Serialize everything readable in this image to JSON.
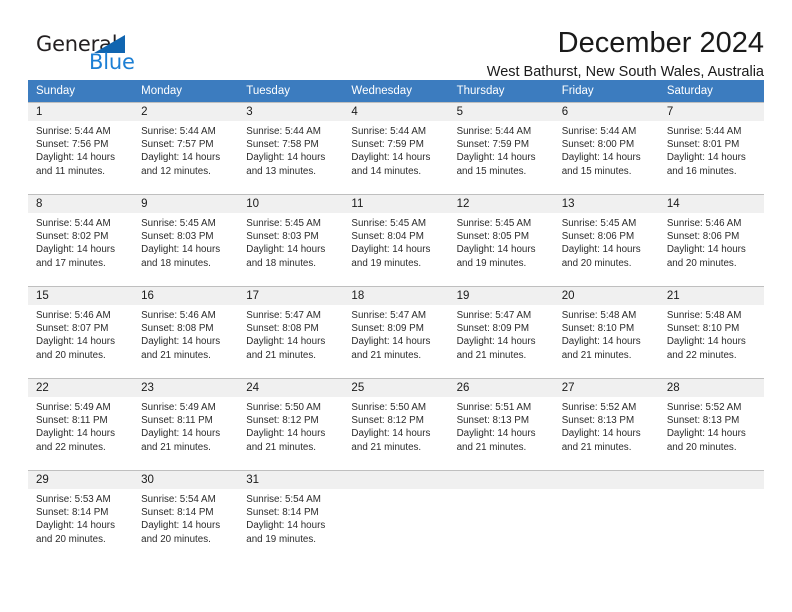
{
  "brand": {
    "name_part1": "General",
    "name_part2": "Blue",
    "triangle_color": "#1065b0",
    "blue_color": "#1c7fd4"
  },
  "header": {
    "month_title": "December 2024",
    "location": "West Bathurst, New South Wales, Australia"
  },
  "theme": {
    "header_row_bg": "#3c7cbf",
    "daynum_bg": "#f0f0f0",
    "grid_line": "#bfbfbf"
  },
  "weekdays": [
    "Sunday",
    "Monday",
    "Tuesday",
    "Wednesday",
    "Thursday",
    "Friday",
    "Saturday"
  ],
  "weeks": [
    [
      {
        "day": "1",
        "sunrise": "Sunrise: 5:44 AM",
        "sunset": "Sunset: 7:56 PM",
        "daylight1": "Daylight: 14 hours",
        "daylight2": "and 11 minutes."
      },
      {
        "day": "2",
        "sunrise": "Sunrise: 5:44 AM",
        "sunset": "Sunset: 7:57 PM",
        "daylight1": "Daylight: 14 hours",
        "daylight2": "and 12 minutes."
      },
      {
        "day": "3",
        "sunrise": "Sunrise: 5:44 AM",
        "sunset": "Sunset: 7:58 PM",
        "daylight1": "Daylight: 14 hours",
        "daylight2": "and 13 minutes."
      },
      {
        "day": "4",
        "sunrise": "Sunrise: 5:44 AM",
        "sunset": "Sunset: 7:59 PM",
        "daylight1": "Daylight: 14 hours",
        "daylight2": "and 14 minutes."
      },
      {
        "day": "5",
        "sunrise": "Sunrise: 5:44 AM",
        "sunset": "Sunset: 7:59 PM",
        "daylight1": "Daylight: 14 hours",
        "daylight2": "and 15 minutes."
      },
      {
        "day": "6",
        "sunrise": "Sunrise: 5:44 AM",
        "sunset": "Sunset: 8:00 PM",
        "daylight1": "Daylight: 14 hours",
        "daylight2": "and 15 minutes."
      },
      {
        "day": "7",
        "sunrise": "Sunrise: 5:44 AM",
        "sunset": "Sunset: 8:01 PM",
        "daylight1": "Daylight: 14 hours",
        "daylight2": "and 16 minutes."
      }
    ],
    [
      {
        "day": "8",
        "sunrise": "Sunrise: 5:44 AM",
        "sunset": "Sunset: 8:02 PM",
        "daylight1": "Daylight: 14 hours",
        "daylight2": "and 17 minutes."
      },
      {
        "day": "9",
        "sunrise": "Sunrise: 5:45 AM",
        "sunset": "Sunset: 8:03 PM",
        "daylight1": "Daylight: 14 hours",
        "daylight2": "and 18 minutes."
      },
      {
        "day": "10",
        "sunrise": "Sunrise: 5:45 AM",
        "sunset": "Sunset: 8:03 PM",
        "daylight1": "Daylight: 14 hours",
        "daylight2": "and 18 minutes."
      },
      {
        "day": "11",
        "sunrise": "Sunrise: 5:45 AM",
        "sunset": "Sunset: 8:04 PM",
        "daylight1": "Daylight: 14 hours",
        "daylight2": "and 19 minutes."
      },
      {
        "day": "12",
        "sunrise": "Sunrise: 5:45 AM",
        "sunset": "Sunset: 8:05 PM",
        "daylight1": "Daylight: 14 hours",
        "daylight2": "and 19 minutes."
      },
      {
        "day": "13",
        "sunrise": "Sunrise: 5:45 AM",
        "sunset": "Sunset: 8:06 PM",
        "daylight1": "Daylight: 14 hours",
        "daylight2": "and 20 minutes."
      },
      {
        "day": "14",
        "sunrise": "Sunrise: 5:46 AM",
        "sunset": "Sunset: 8:06 PM",
        "daylight1": "Daylight: 14 hours",
        "daylight2": "and 20 minutes."
      }
    ],
    [
      {
        "day": "15",
        "sunrise": "Sunrise: 5:46 AM",
        "sunset": "Sunset: 8:07 PM",
        "daylight1": "Daylight: 14 hours",
        "daylight2": "and 20 minutes."
      },
      {
        "day": "16",
        "sunrise": "Sunrise: 5:46 AM",
        "sunset": "Sunset: 8:08 PM",
        "daylight1": "Daylight: 14 hours",
        "daylight2": "and 21 minutes."
      },
      {
        "day": "17",
        "sunrise": "Sunrise: 5:47 AM",
        "sunset": "Sunset: 8:08 PM",
        "daylight1": "Daylight: 14 hours",
        "daylight2": "and 21 minutes."
      },
      {
        "day": "18",
        "sunrise": "Sunrise: 5:47 AM",
        "sunset": "Sunset: 8:09 PM",
        "daylight1": "Daylight: 14 hours",
        "daylight2": "and 21 minutes."
      },
      {
        "day": "19",
        "sunrise": "Sunrise: 5:47 AM",
        "sunset": "Sunset: 8:09 PM",
        "daylight1": "Daylight: 14 hours",
        "daylight2": "and 21 minutes."
      },
      {
        "day": "20",
        "sunrise": "Sunrise: 5:48 AM",
        "sunset": "Sunset: 8:10 PM",
        "daylight1": "Daylight: 14 hours",
        "daylight2": "and 21 minutes."
      },
      {
        "day": "21",
        "sunrise": "Sunrise: 5:48 AM",
        "sunset": "Sunset: 8:10 PM",
        "daylight1": "Daylight: 14 hours",
        "daylight2": "and 22 minutes."
      }
    ],
    [
      {
        "day": "22",
        "sunrise": "Sunrise: 5:49 AM",
        "sunset": "Sunset: 8:11 PM",
        "daylight1": "Daylight: 14 hours",
        "daylight2": "and 22 minutes."
      },
      {
        "day": "23",
        "sunrise": "Sunrise: 5:49 AM",
        "sunset": "Sunset: 8:11 PM",
        "daylight1": "Daylight: 14 hours",
        "daylight2": "and 21 minutes."
      },
      {
        "day": "24",
        "sunrise": "Sunrise: 5:50 AM",
        "sunset": "Sunset: 8:12 PM",
        "daylight1": "Daylight: 14 hours",
        "daylight2": "and 21 minutes."
      },
      {
        "day": "25",
        "sunrise": "Sunrise: 5:50 AM",
        "sunset": "Sunset: 8:12 PM",
        "daylight1": "Daylight: 14 hours",
        "daylight2": "and 21 minutes."
      },
      {
        "day": "26",
        "sunrise": "Sunrise: 5:51 AM",
        "sunset": "Sunset: 8:13 PM",
        "daylight1": "Daylight: 14 hours",
        "daylight2": "and 21 minutes."
      },
      {
        "day": "27",
        "sunrise": "Sunrise: 5:52 AM",
        "sunset": "Sunset: 8:13 PM",
        "daylight1": "Daylight: 14 hours",
        "daylight2": "and 21 minutes."
      },
      {
        "day": "28",
        "sunrise": "Sunrise: 5:52 AM",
        "sunset": "Sunset: 8:13 PM",
        "daylight1": "Daylight: 14 hours",
        "daylight2": "and 20 minutes."
      }
    ],
    [
      {
        "day": "29",
        "sunrise": "Sunrise: 5:53 AM",
        "sunset": "Sunset: 8:14 PM",
        "daylight1": "Daylight: 14 hours",
        "daylight2": "and 20 minutes."
      },
      {
        "day": "30",
        "sunrise": "Sunrise: 5:54 AM",
        "sunset": "Sunset: 8:14 PM",
        "daylight1": "Daylight: 14 hours",
        "daylight2": "and 20 minutes."
      },
      {
        "day": "31",
        "sunrise": "Sunrise: 5:54 AM",
        "sunset": "Sunset: 8:14 PM",
        "daylight1": "Daylight: 14 hours",
        "daylight2": "and 19 minutes."
      },
      {
        "day": "",
        "sunrise": "",
        "sunset": "",
        "daylight1": "",
        "daylight2": ""
      },
      {
        "day": "",
        "sunrise": "",
        "sunset": "",
        "daylight1": "",
        "daylight2": ""
      },
      {
        "day": "",
        "sunrise": "",
        "sunset": "",
        "daylight1": "",
        "daylight2": ""
      },
      {
        "day": "",
        "sunrise": "",
        "sunset": "",
        "daylight1": "",
        "daylight2": ""
      }
    ]
  ]
}
